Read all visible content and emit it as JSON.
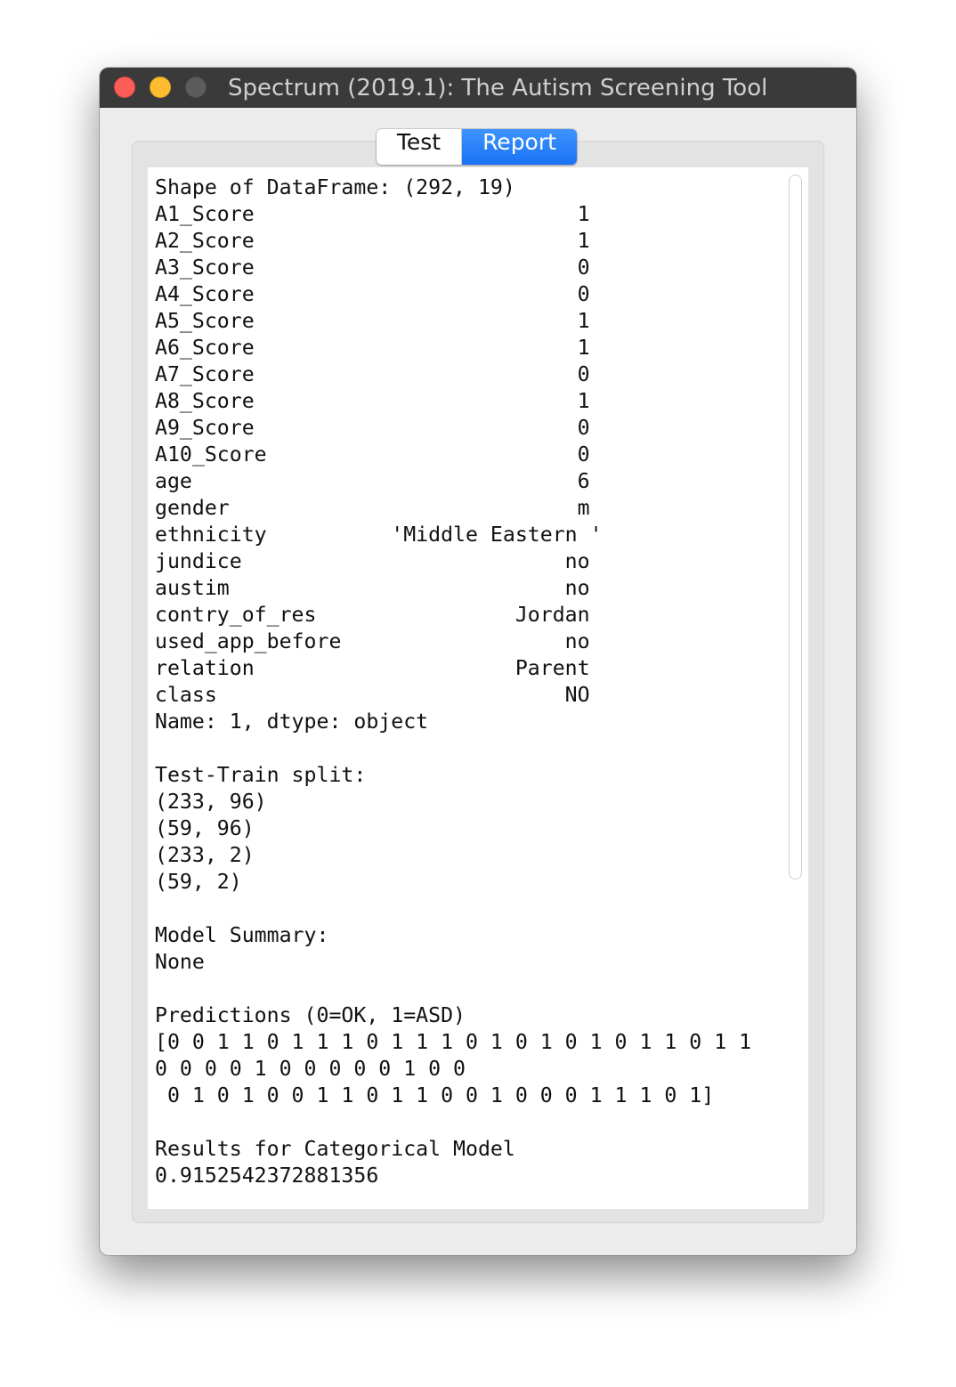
{
  "window": {
    "title": "Spectrum (2019.1): The Autism Screening Tool"
  },
  "tabs": [
    {
      "label": "Test",
      "selected": false
    },
    {
      "label": "Report",
      "selected": true
    }
  ],
  "colors": {
    "accent": "#1a72f5",
    "titlebar": "#3a3a3a"
  },
  "report": {
    "text": "Shape of DataFrame: (292, 19)\nA1_Score                          1\nA2_Score                          1\nA3_Score                          0\nA4_Score                          0\nA5_Score                          1\nA6_Score                          1\nA7_Score                          0\nA8_Score                          1\nA9_Score                          0\nA10_Score                         0\nage                               6\ngender                            m\nethnicity          'Middle Eastern '\njundice                          no\naustim                           no\ncontry_of_res                Jordan\nused_app_before                  no\nrelation                     Parent\nclass                            NO\nName: 1, dtype: object\n\nTest-Train split:\n(233, 96)\n(59, 96)\n(233, 2)\n(59, 2)\n\nModel Summary:\nNone\n\nPredictions (0=OK, 1=ASD)\n[0 0 1 1 0 1 1 1 0 1 1 1 0 1 0 1 0 1 0 1 1 0 1 1\n0 0 0 0 1 0 0 0 0 0 1 0 0\n 0 1 0 1 0 0 1 1 0 1 1 0 0 1 0 0 0 1 1 1 0 1]\n\nResults for Categorical Model\n0.9152542372881356"
  }
}
